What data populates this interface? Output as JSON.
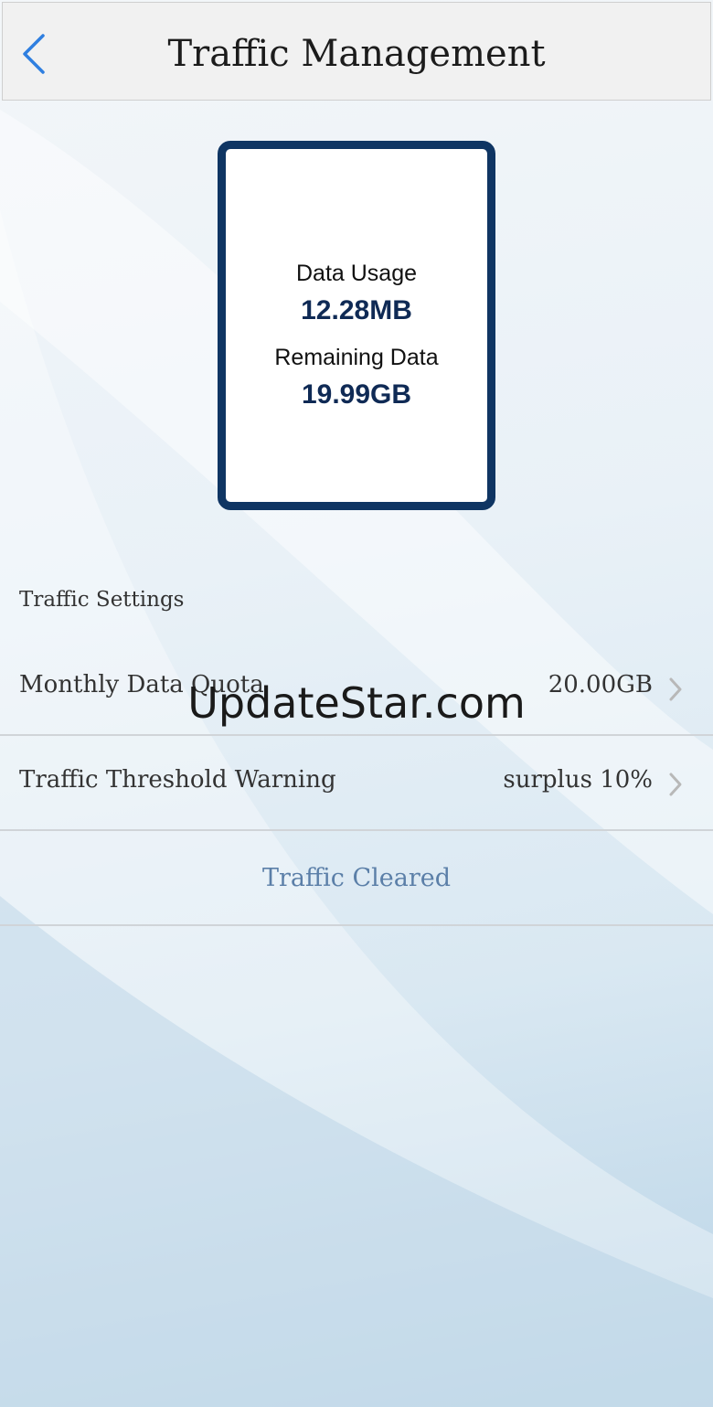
{
  "header": {
    "title": "Traffic Management",
    "back_icon": "chevron-left-icon",
    "accent_color": "#2f7fe0"
  },
  "usage_card": {
    "data_usage_label": "Data Usage",
    "data_usage_value": "12.28MB",
    "remaining_label": "Remaining Data",
    "remaining_value": "19.99GB",
    "border_color": "#0f3563"
  },
  "settings": {
    "section_label": "Traffic Settings",
    "rows": [
      {
        "label": "Monthly Data Quota",
        "value": "20.00GB",
        "icon": "chevron-right-icon"
      },
      {
        "label": "Traffic Threshold Warning",
        "value": "surplus 10%",
        "icon": "chevron-right-icon"
      }
    ],
    "clear_label": "Traffic Cleared"
  },
  "watermark": {
    "text": "UpdateStar.com"
  }
}
